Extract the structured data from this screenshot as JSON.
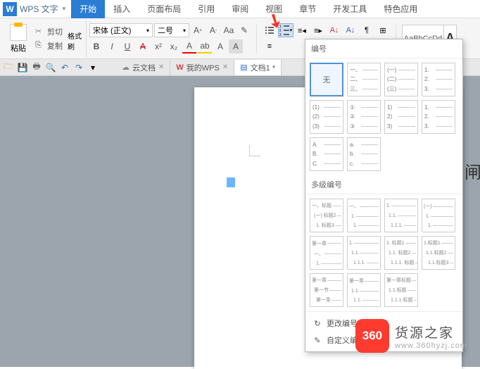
{
  "app": {
    "logo": "W",
    "name": "WPS 文字"
  },
  "menu": [
    "开始",
    "插入",
    "页面布局",
    "引用",
    "审阅",
    "视图",
    "章节",
    "开发工具",
    "特色应用"
  ],
  "menu_active": 0,
  "toolbar": {
    "paste": "粘贴",
    "cut": "剪切",
    "copy": "复制",
    "format_painter": "格式刷",
    "font_name": "宋体 (正文)",
    "font_size": "二号",
    "bold": "B",
    "italic": "I",
    "underline": "U",
    "strike": "A",
    "sup": "x²",
    "sub": "x₂",
    "style_preview": "AaBbCcDd"
  },
  "tabs": [
    {
      "icon": "cloud",
      "label": "云文档"
    },
    {
      "icon": "w",
      "label": "我的WPS"
    },
    {
      "icon": "doc",
      "label": "文档1 *"
    }
  ],
  "numbering": {
    "header": "编号",
    "none": "无",
    "simple": [
      [
        "一、",
        "二、",
        "三、"
      ],
      [
        "(一)",
        "(二)",
        "(三)"
      ],
      [
        "1.",
        "2.",
        "3."
      ],
      [
        "(1)",
        "(2)",
        "(3)"
      ],
      [
        "①",
        "②",
        "③"
      ],
      [
        "1)",
        "2)",
        "3)"
      ],
      [
        "1.",
        "2.",
        "3."
      ],
      [
        "A.",
        "B.",
        "C."
      ],
      [
        "a.",
        "b.",
        "c."
      ]
    ],
    "multi_header": "多级编号",
    "multi": [
      [
        "一、标题",
        "(一) 标题2",
        "1. 标题3"
      ],
      [
        "一、",
        "1.",
        "1."
      ],
      [
        "1.",
        "1.1.",
        "1.1.1."
      ],
      [
        "(一)",
        "1.",
        "1."
      ],
      [
        "第一章",
        "一、",
        "1."
      ],
      [
        "1.",
        "1.1.",
        "1.1.1."
      ],
      [
        "1. 标题1",
        "1.1. 标题2",
        "1.1.1. 标题"
      ],
      [
        "1.标题1",
        "1.1.标题2",
        "1.1.标题3"
      ],
      [
        "第一章",
        "第一节",
        "第一条"
      ],
      [
        "第一章",
        "1.1.",
        "1.1."
      ],
      [
        "第一章标题",
        "1.1.标题",
        "1.1.1.标题"
      ]
    ],
    "change": "更改编号",
    "custom": "自定义编号"
  },
  "watermark": {
    "logo": "360",
    "title": "货源之家",
    "url": "www.360hyzj.com"
  },
  "char_preview": "闸"
}
